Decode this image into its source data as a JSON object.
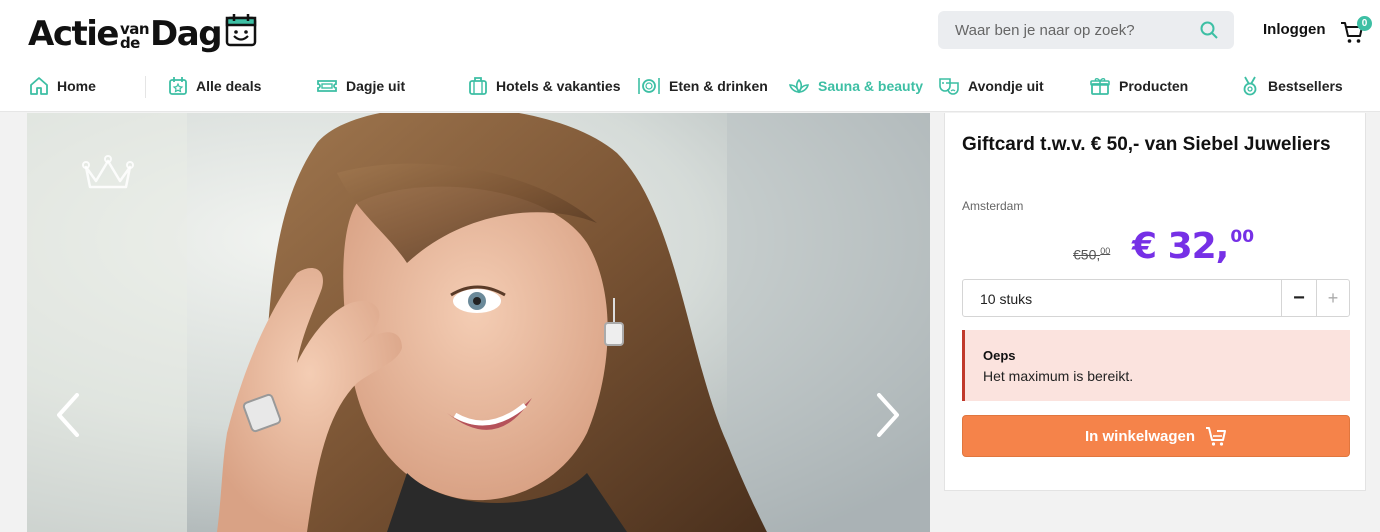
{
  "header": {
    "logo": {
      "part1": "Actie",
      "small_top": "van",
      "small_bottom": "de",
      "part2": "Dag"
    },
    "search": {
      "placeholder": "Waar ben je naar op zoek?",
      "value": ""
    },
    "login_label": "Inloggen",
    "cart_count": "0"
  },
  "nav": {
    "items": [
      {
        "label": "Home",
        "icon": "home-icon"
      },
      {
        "label": "Alle deals",
        "icon": "calendar-star-icon"
      },
      {
        "label": "Dagje uit",
        "icon": "ticket-icon"
      },
      {
        "label": "Hotels & vakanties",
        "icon": "suitcase-icon"
      },
      {
        "label": "Eten & drinken",
        "icon": "plate-cutlery-icon"
      },
      {
        "label": "Sauna & beauty",
        "icon": "lotus-icon",
        "active": true
      },
      {
        "label": "Avondje uit",
        "icon": "theater-masks-icon"
      },
      {
        "label": "Producten",
        "icon": "gift-box-icon"
      },
      {
        "label": "Bestsellers",
        "icon": "award-medal-icon"
      }
    ]
  },
  "product": {
    "title": "Giftcard t.w.v. € 50,- van Siebel Juweliers",
    "location": "Amsterdam",
    "old_price_main": "€50,",
    "old_price_cents": "00",
    "new_price_main": "€ 32,",
    "new_price_cents": "00",
    "quantity": "10 stuks",
    "minus_label": "−",
    "plus_label": "+",
    "alert_title": "Oeps",
    "alert_message": "Het maximum is bereikt.",
    "buy_label": "In winkelwagen"
  },
  "colors": {
    "accent_teal": "#3dbfa4",
    "price_purple": "#7630e6",
    "buy_orange": "#f5834a",
    "alert_bg": "#fbe3de",
    "alert_border": "#c0392b"
  }
}
